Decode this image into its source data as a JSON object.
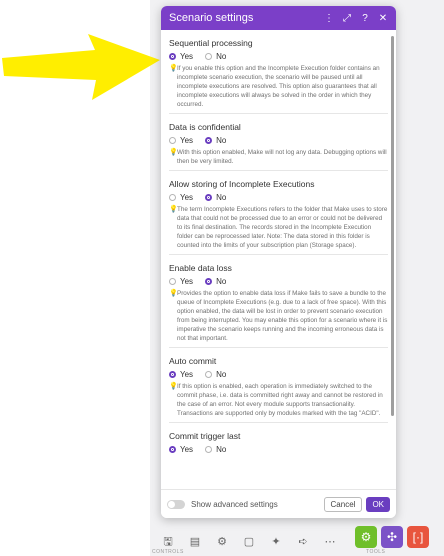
{
  "dialog": {
    "title": "Scenario settings",
    "header_icons": [
      "more-vertical-icon",
      "expand-icon",
      "help-icon",
      "close-icon"
    ],
    "sections": [
      {
        "title": "Sequential processing",
        "options": [
          "Yes",
          "No"
        ],
        "selected": "Yes",
        "hint": "If you enable this option and the Incomplete Execution folder contains an incomplete scenario execution, the scenario will be paused until all incomplete executions are resolved. This option also guarantees that all incomplete executions will always be solved in the order in which they occurred."
      },
      {
        "title": "Data is confidential",
        "options": [
          "Yes",
          "No"
        ],
        "selected": "No",
        "hint": "With this option enabled, Make will not log any data. Debugging options will then be very limited."
      },
      {
        "title": "Allow storing of Incomplete Executions",
        "options": [
          "Yes",
          "No"
        ],
        "selected": "No",
        "hint": "The term Incomplete Executions refers to the folder that Make uses to store data that could not be processed due to an error or could not be delivered to its final destination. The records stored in the Incomplete Execution folder can be reprocessed later. Note: The data stored in this folder is counted into the limits of your subscription plan (Storage space)."
      },
      {
        "title": "Enable data loss",
        "options": [
          "Yes",
          "No"
        ],
        "selected": "No",
        "hint": "Provides the option to enable data loss if Make fails to save a bundle to the queue of Incomplete Executions (e.g. due to a lack of free space). With this option enabled, the data will be lost in order to prevent scenario execution from being interrupted. You may enable this option for a scenario where it is imperative the scenario keeps running and the incoming erroneous data is not that important."
      },
      {
        "title": "Auto commit",
        "options": [
          "Yes",
          "No"
        ],
        "selected": "Yes",
        "hint": "If this option is enabled, each operation is immediately switched to the commit phase, i.e. data is committed right away and cannot be restored in the case of an error. Not every module supports transactionality. Transactions are supported only by modules marked with the tag \"ACID\"."
      },
      {
        "title": "Commit trigger last",
        "options": [
          "Yes",
          "No"
        ],
        "selected": "Yes",
        "hint": ""
      }
    ],
    "footer": {
      "advanced_label": "Show advanced settings",
      "cancel_label": "Cancel",
      "ok_label": "OK"
    }
  },
  "toolbar": {
    "controls_label": "CONTROLS",
    "tools_label": "TOOLS",
    "icons": [
      "save-icon",
      "scheduling-icon",
      "settings-icon",
      "notes-icon",
      "magic-wand-icon",
      "flow-icon",
      "more-icon"
    ],
    "tool_colors": {
      "green": "#6fbf2a",
      "purple": "#7b52c7",
      "red": "#e8553e"
    }
  },
  "annotation": {
    "arrow_color": "#ffee00"
  }
}
